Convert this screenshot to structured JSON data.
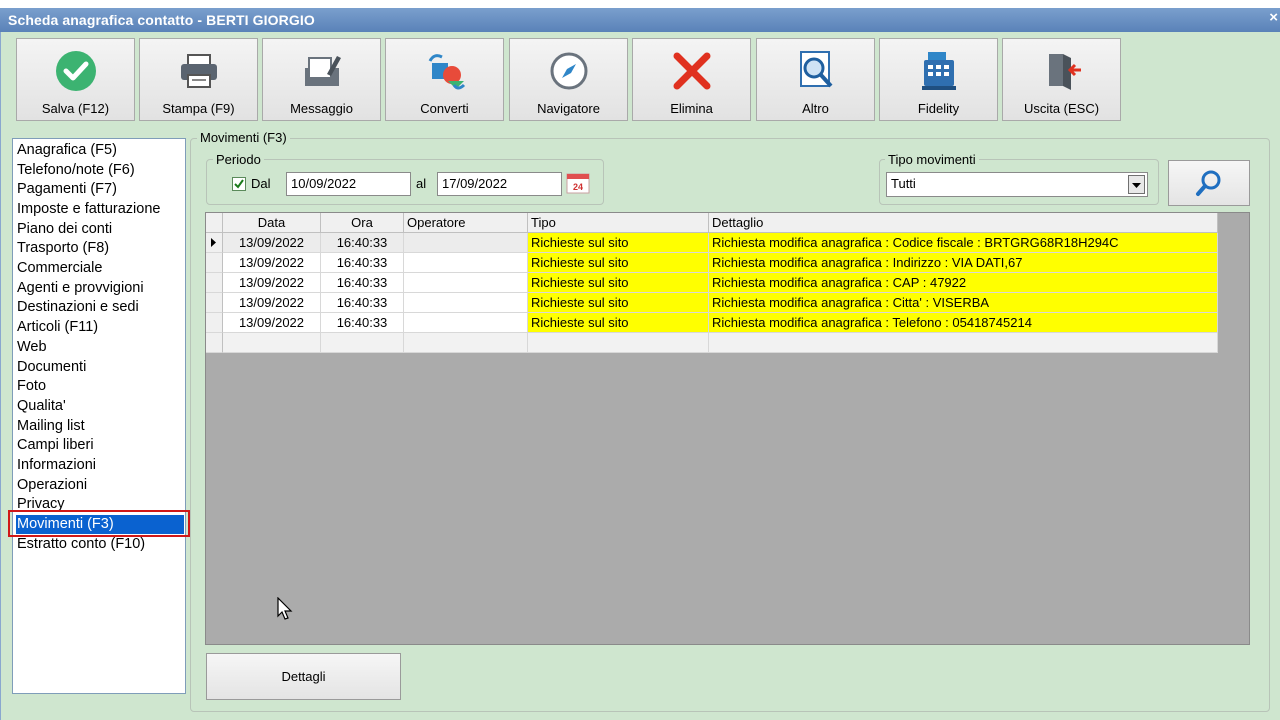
{
  "window": {
    "title": "Scheda anagrafica contatto - BERTI GIORGIO",
    "close": "×"
  },
  "toolbar": {
    "buttons": [
      {
        "label": "Salva (F12)",
        "icon": "check-icon"
      },
      {
        "label": "Stampa (F9)",
        "icon": "printer-icon"
      },
      {
        "label": "Messaggio",
        "icon": "message-icon"
      },
      {
        "label": "Converti",
        "icon": "convert-icon"
      },
      {
        "label": "Navigatore",
        "icon": "compass-icon"
      },
      {
        "label": "Elimina",
        "icon": "delete-icon"
      },
      {
        "label": "Altro",
        "icon": "search-doc-icon"
      },
      {
        "label": "Fidelity",
        "icon": "cash-register-icon"
      },
      {
        "label": "Uscita (ESC)",
        "icon": "exit-icon"
      }
    ]
  },
  "menu": {
    "items": [
      "Anagrafica (F5)",
      "Telefono/note (F6)",
      "Pagamenti (F7)",
      "Imposte e fatturazione",
      "Piano dei conti",
      "Trasporto (F8)",
      "Commerciale",
      "Agenti e provvigioni",
      "Destinazioni e sedi",
      "Articoli (F11)",
      "Web",
      "Documenti",
      "Foto",
      "Qualita'",
      "Mailing list",
      "Campi liberi",
      "Informazioni",
      "Operazioni",
      "Privacy",
      "Movimenti (F3)",
      "Estratto conto (F10)"
    ],
    "selected_index": 19
  },
  "movimenti": {
    "group_label": "Movimenti (F3)",
    "periodo": {
      "label": "Periodo",
      "dal_label": "Dal",
      "dal_checked": true,
      "dal_value": "10/09/2022",
      "al_label": "al",
      "al_value": "17/09/2022",
      "calendar_day": "24"
    },
    "tipo": {
      "label": "Tipo movimenti",
      "value": "Tutti"
    },
    "table": {
      "columns": [
        "Data",
        "Ora",
        "Operatore",
        "Tipo",
        "Dettaglio"
      ],
      "rows": [
        [
          "13/09/2022",
          "16:40:33",
          "",
          "Richieste sul sito",
          "Richiesta modifica anagrafica : Codice fiscale : BRTGRG68R18H294C"
        ],
        [
          "13/09/2022",
          "16:40:33",
          "",
          "Richieste sul sito",
          "Richiesta modifica anagrafica : Indirizzo : VIA DATI,67"
        ],
        [
          "13/09/2022",
          "16:40:33",
          "",
          "Richieste sul sito",
          "Richiesta modifica anagrafica : CAP : 47922"
        ],
        [
          "13/09/2022",
          "16:40:33",
          "",
          "Richieste sul sito",
          "Richiesta modifica anagrafica : Citta' : VISERBA"
        ],
        [
          "13/09/2022",
          "16:40:33",
          "",
          "Richieste sul sito",
          "Richiesta modifica anagrafica : Telefono : 05418745214"
        ]
      ]
    },
    "dettagli_button": "Dettagli"
  },
  "colors": {
    "title_bar": "#5a82b8",
    "highlight": "#ffff00",
    "selection": "#0a62d0",
    "outline": "#d01818",
    "background": "#cfe6cf"
  }
}
